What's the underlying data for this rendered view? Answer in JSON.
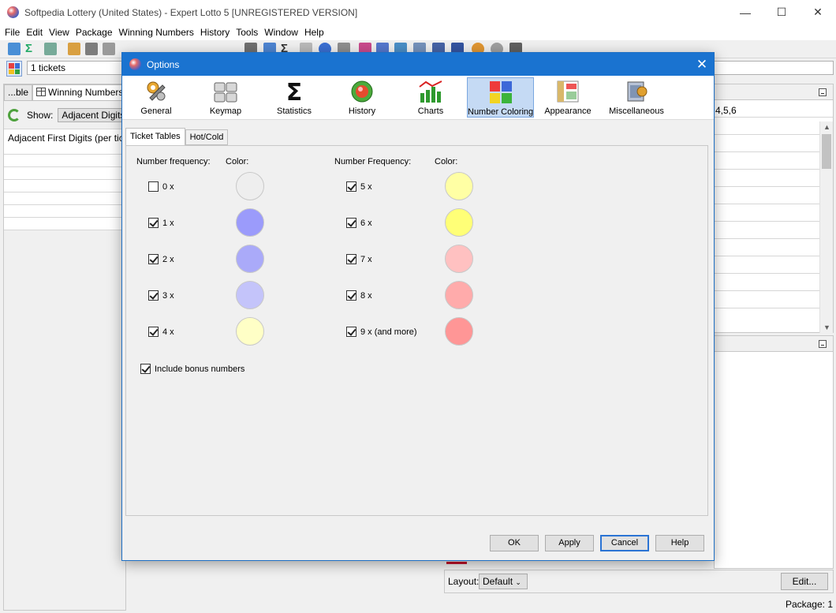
{
  "window": {
    "title": "Softpedia Lottery (United States) - Expert Lotto 5 [UNREGISTERED VERSION]"
  },
  "menu": [
    "File",
    "Edit",
    "View",
    "Package",
    "Winning Numbers",
    "History",
    "Tools",
    "Window",
    "Help"
  ],
  "toolbar": {
    "tickets_label": "1 tickets"
  },
  "left_panel": {
    "tabs": [
      "...ble",
      "Winning Numbers"
    ],
    "show_label": "Show:",
    "show_value": "Adjacent Digits",
    "table_header": "Adjacent First Digits (per ticket)"
  },
  "right_panel": {
    "value": "4,5,6"
  },
  "layout": {
    "label": "Layout:",
    "value": "Default",
    "edit_button": "Edit..."
  },
  "status": {
    "package": "Package: 1"
  },
  "dialog": {
    "title": "Options",
    "categories": [
      {
        "label": "General",
        "icon": "gears-icon"
      },
      {
        "label": "Keymap",
        "icon": "keyboard-icon"
      },
      {
        "label": "Statistics",
        "icon": "sigma-icon"
      },
      {
        "label": "History",
        "icon": "history-icon"
      },
      {
        "label": "Charts",
        "icon": "bar-chart-icon"
      },
      {
        "label": "Number Coloring",
        "icon": "color-squares-icon",
        "active": true
      },
      {
        "label": "Appearance",
        "icon": "appearance-icon"
      },
      {
        "label": "Miscellaneous",
        "icon": "misc-icon"
      }
    ],
    "tabs": [
      "Ticket Tables",
      "Hot/Cold"
    ],
    "left_col": {
      "freq_header": "Number frequency:",
      "color_header": "Color:",
      "rows": [
        {
          "label": "0 x",
          "checked": false,
          "color": "#eeeeee"
        },
        {
          "label": "1 x",
          "checked": true,
          "color": "#9b9bfb"
        },
        {
          "label": "2 x",
          "checked": true,
          "color": "#aaaaf9"
        },
        {
          "label": "3 x",
          "checked": true,
          "color": "#c4c4fa"
        },
        {
          "label": "4 x",
          "checked": true,
          "color": "#ffffc6"
        }
      ]
    },
    "right_col": {
      "freq_header": "Number Frequency:",
      "color_header": "Color:",
      "rows": [
        {
          "label": "5 x",
          "checked": true,
          "color": "#ffffa4"
        },
        {
          "label": "6 x",
          "checked": true,
          "color": "#ffff77"
        },
        {
          "label": "7 x",
          "checked": true,
          "color": "#ffc1c1"
        },
        {
          "label": "8 x",
          "checked": true,
          "color": "#ffabab"
        },
        {
          "label": "9 x (and more)",
          "checked": true,
          "color": "#ff9696"
        }
      ]
    },
    "bonus": {
      "label": "Include bonus numbers",
      "checked": true
    },
    "buttons": {
      "ok": "OK",
      "apply": "Apply",
      "cancel": "Cancel",
      "help": "Help"
    }
  }
}
